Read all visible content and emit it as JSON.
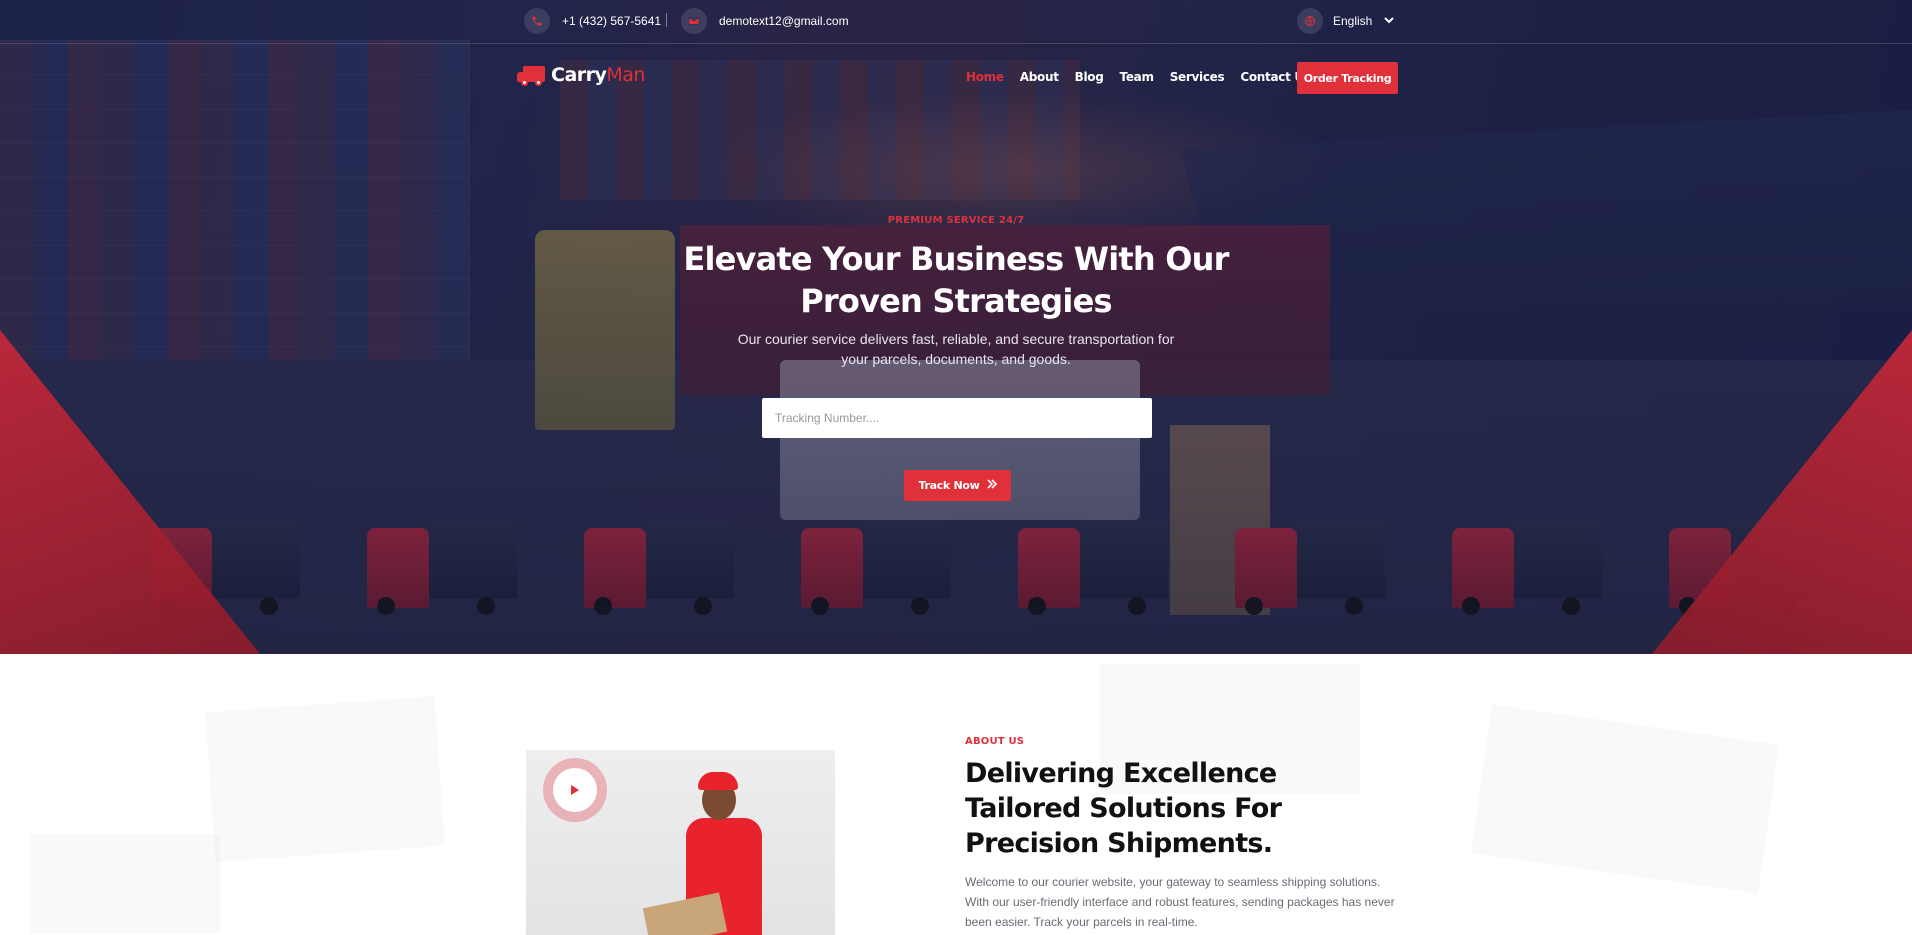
{
  "topbar": {
    "phone": "+1 (432) 567-5641",
    "email": "demotext12@gmail.com",
    "language": "English",
    "phone_icon": "phone-icon",
    "email_icon": "envelope-icon",
    "globe_icon": "globe-icon"
  },
  "logo": {
    "part1": "Carry",
    "part2": "Man"
  },
  "nav": {
    "items": [
      {
        "label": "Home",
        "active": true
      },
      {
        "label": "About",
        "active": false
      },
      {
        "label": "Blog",
        "active": false
      },
      {
        "label": "Team",
        "active": false
      },
      {
        "label": "Services",
        "active": false
      },
      {
        "label": "Contact Us",
        "active": false
      }
    ],
    "cta": "Order Tracking"
  },
  "hero": {
    "eyebrow": "PREMIUM SERVICE 24/7",
    "title": "Elevate Your Business With Our Proven Strategies",
    "description": "Our courier service delivers fast, reliable, and secure transportation for your parcels, documents, and goods.",
    "tracking_placeholder": "Tracking Number....",
    "tracking_value": "",
    "track_button": "Track Now",
    "track_icon": "double-chevron-right-icon"
  },
  "about": {
    "eyebrow": "ABOUT US",
    "title": "Delivering Excellence Tailored Solutions For Precision Shipments.",
    "description": "Welcome to our courier website, your gateway to seamless shipping solutions. With our user-friendly interface and robust features, sending packages has never been easier. Track your parcels in real-time.",
    "play_icon": "play-icon"
  },
  "colors": {
    "accent": "#e0303a",
    "hero_overlay": "#1a1e42",
    "text_dark": "#111111",
    "text_muted": "#6b6b75"
  }
}
